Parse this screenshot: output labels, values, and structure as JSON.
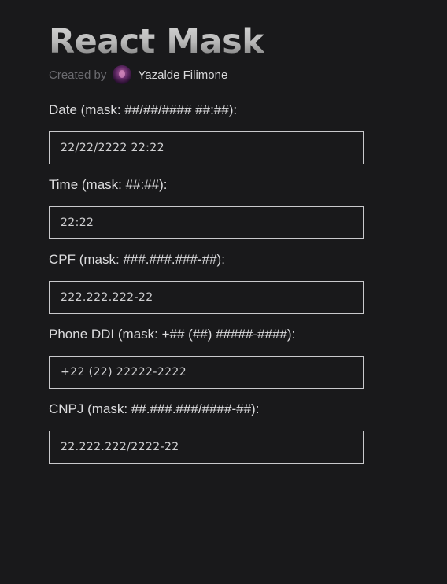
{
  "header": {
    "title": "React Mask",
    "created_by_label": "Created by",
    "author_name": "Yazalde Filimone"
  },
  "fields": [
    {
      "label": "Date (mask: ##/##/#### ##:##):",
      "value": "22/22/2222 22:22"
    },
    {
      "label": "Time (mask: ##:##):",
      "value": "22:22"
    },
    {
      "label": "CPF (mask: ###.###.###-##):",
      "value": "222.222.222-22"
    },
    {
      "label": "Phone DDI (mask: +## (##) #####-####):",
      "value": "+22 (22) 22222-2222"
    },
    {
      "label": "CNPJ (mask: ##.###.###/####-##):",
      "value": "22.222.222/2222-22"
    }
  ]
}
